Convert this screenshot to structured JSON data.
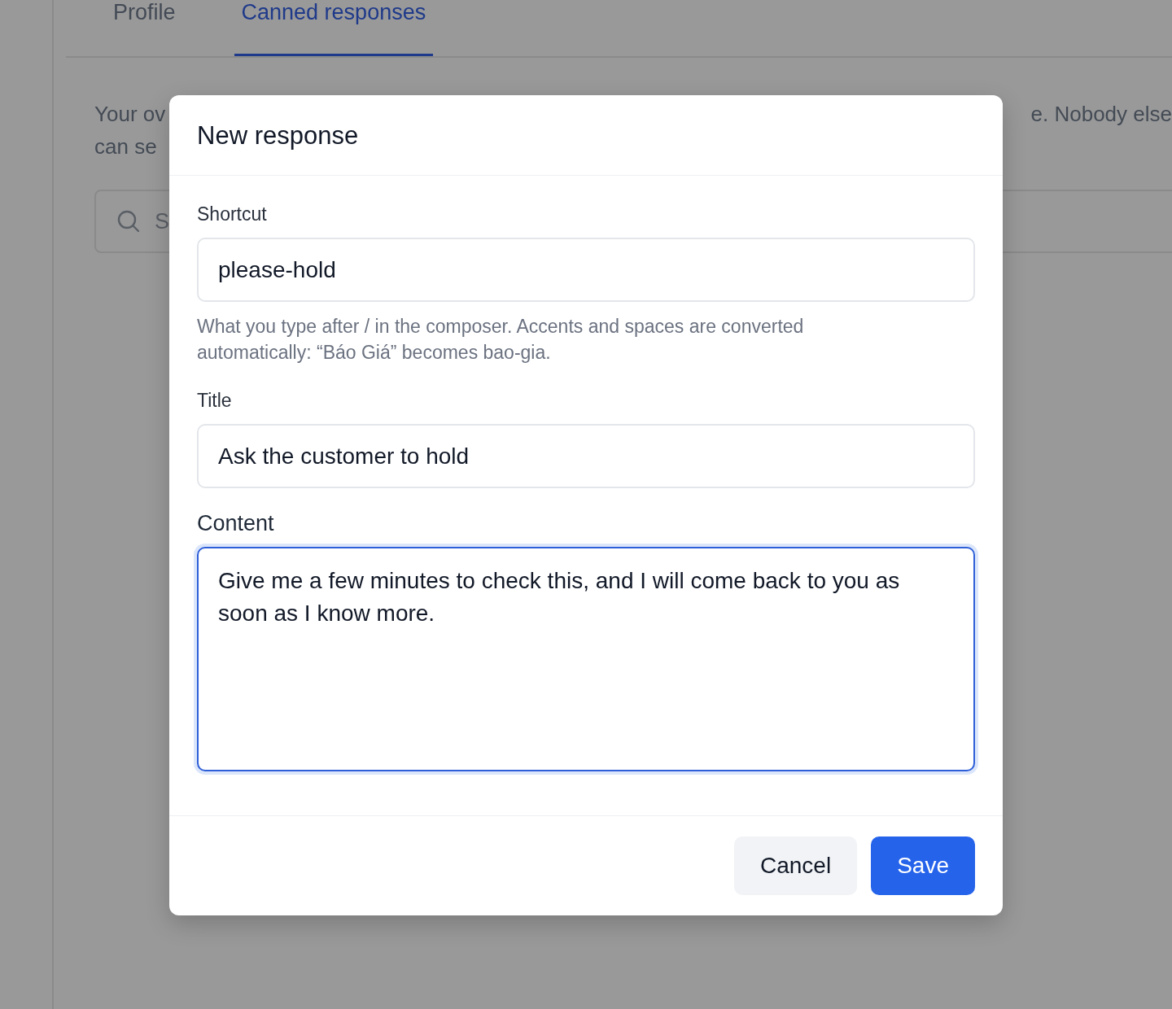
{
  "tabs": [
    {
      "label": "Profile",
      "selected": false
    },
    {
      "label": "Canned responses",
      "selected": true
    }
  ],
  "intro": {
    "left_lines": [
      "Your ov",
      "can se"
    ],
    "right_lines": [
      "e. Nobody else"
    ]
  },
  "search": {
    "placeholder": "S"
  },
  "dialog": {
    "title": "New response",
    "fields": [
      {
        "kind": "input",
        "label": "Shortcut",
        "value": "please-hold",
        "hint": "What you type after / in the composer. Accents and spaces are converted automatically: “Báo Giá” becomes bao-gia.",
        "focused": false
      },
      {
        "kind": "input",
        "label": "Title",
        "value": "Ask the customer to hold",
        "focused": false
      },
      {
        "kind": "textarea",
        "label": "Content",
        "value": "Give me a few minutes to check this, and I will come back to you as soon as I know more.",
        "focused": true
      }
    ],
    "buttons": [
      {
        "kind": "secondary",
        "label": "Cancel"
      },
      {
        "kind": "primary",
        "label": "Save"
      }
    ]
  }
}
